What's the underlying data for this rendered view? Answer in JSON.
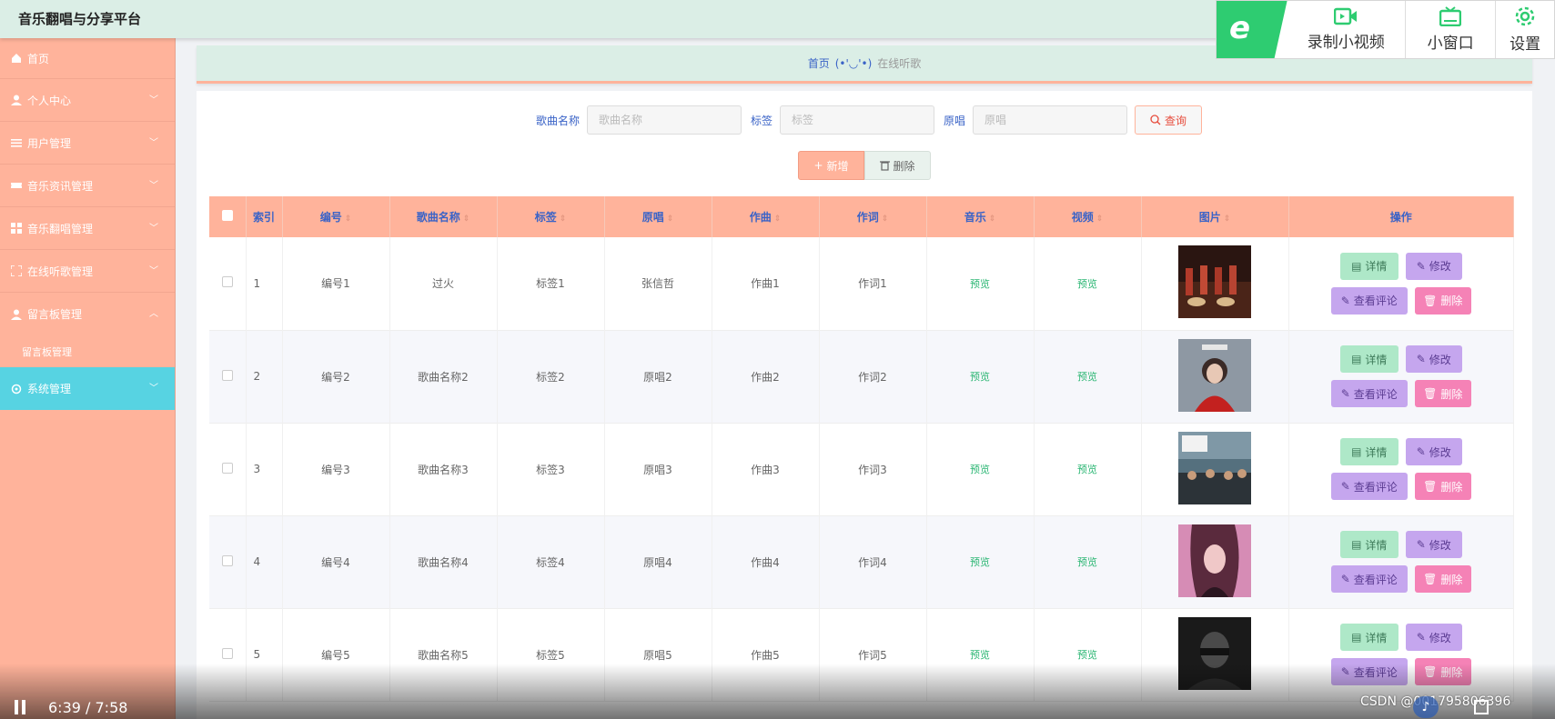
{
  "app_title": "音乐翻唱与分享平台",
  "recorder": {
    "logo": "e",
    "record_label": "录制小视频",
    "mini_label": "小窗口",
    "settings_label": "设置"
  },
  "sidebar": {
    "items": [
      {
        "label": "首页",
        "icon": "home-icon"
      },
      {
        "label": "个人中心",
        "icon": "user-icon"
      },
      {
        "label": "用户管理",
        "icon": "list-icon"
      },
      {
        "label": "音乐资讯管理",
        "icon": "ticket-icon"
      },
      {
        "label": "音乐翻唱管理",
        "icon": "grid-icon"
      },
      {
        "label": "在线听歌管理",
        "icon": "frame-icon"
      },
      {
        "label": "留言板管理",
        "icon": "user-icon"
      }
    ],
    "submenu_label": "留言板管理",
    "system_label": "系统管理"
  },
  "breadcrumb": {
    "home": "首页",
    "face": "(•'◡'•)",
    "current": "在线听歌"
  },
  "search": {
    "song_label": "歌曲名称",
    "song_placeholder": "歌曲名称",
    "tag_label": "标签",
    "tag_placeholder": "标签",
    "original_label": "原唱",
    "original_placeholder": "原唱",
    "query_label": "查询"
  },
  "actions": {
    "add_label": "新增",
    "delete_label": "删除"
  },
  "table": {
    "headers": [
      "索引",
      "编号",
      "歌曲名称",
      "标签",
      "原唱",
      "作曲",
      "作词",
      "音乐",
      "视频",
      "图片",
      "操作"
    ],
    "rows": [
      {
        "index": "1",
        "code": "编号1",
        "song": "过火",
        "tag": "标签1",
        "original": "张信哲",
        "composer": "作曲1",
        "lyricist": "作词1",
        "music": "预览",
        "video": "预览"
      },
      {
        "index": "2",
        "code": "编号2",
        "song": "歌曲名称2",
        "tag": "标签2",
        "original": "原唱2",
        "composer": "作曲2",
        "lyricist": "作词2",
        "music": "预览",
        "video": "预览"
      },
      {
        "index": "3",
        "code": "编号3",
        "song": "歌曲名称3",
        "tag": "标签3",
        "original": "原唱3",
        "composer": "作曲3",
        "lyricist": "作词3",
        "music": "预览",
        "video": "预览"
      },
      {
        "index": "4",
        "code": "编号4",
        "song": "歌曲名称4",
        "tag": "标签4",
        "original": "原唱4",
        "composer": "作曲4",
        "lyricist": "作词4",
        "music": "预览",
        "video": "预览"
      },
      {
        "index": "5",
        "code": "编号5",
        "song": "歌曲名称5",
        "tag": "标签5",
        "original": "原唱5",
        "composer": "作曲5",
        "lyricist": "作词5",
        "music": "预览",
        "video": "预览"
      }
    ],
    "op_labels": {
      "detail": "详情",
      "edit": "修改",
      "comment": "查看评论",
      "remove": "删除"
    }
  },
  "video": {
    "time": "6:39 / 7:58",
    "watermark": "CSDN @001795806396"
  },
  "colors": {
    "sidebar": "#ffb39b",
    "sidebar_active": "#57d3e2",
    "header": "#dbeee6",
    "link": "#3a63c7"
  }
}
